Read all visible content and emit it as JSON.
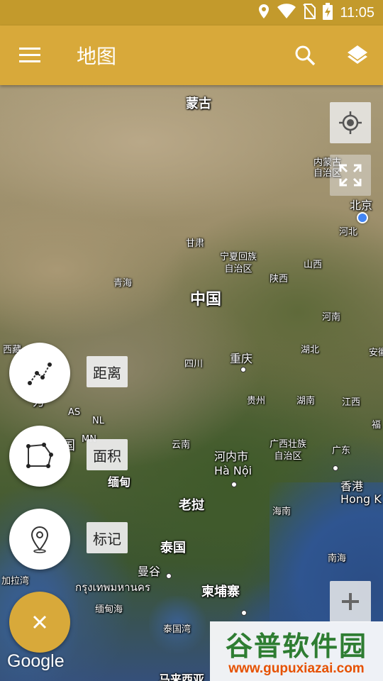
{
  "status_bar": {
    "time": "11:05",
    "icons": [
      "location-icon",
      "wifi-icon",
      "no-sim-icon",
      "battery-charging-icon"
    ]
  },
  "app_bar": {
    "title": "地图",
    "icons": [
      "menu-icon",
      "search-icon",
      "layers-icon"
    ]
  },
  "map": {
    "labels": {
      "mongolia": "蒙古",
      "inner_mongolia": "内蒙古\n自治区",
      "beijing": "北京",
      "hebei": "河北",
      "gansu": "甘肃",
      "ningxia": "宁夏回族\n自治区",
      "shanxi": "山西",
      "shaanxi": "陕西",
      "qinghai": "青海",
      "china": "中国",
      "henan": "河南",
      "tibet": "西藏",
      "sichuan": "四川",
      "chongqing": "重庆",
      "hubei": "湖北",
      "anhui": "安徽",
      "guizhou": "贵州",
      "hunan": "湖南",
      "jiangxi": "江西",
      "fujian": "福",
      "as": "AS",
      "nl": "NL",
      "mn": "MN",
      "yunnan": "云南",
      "hanoi_cn": "河内市",
      "hanoi_vn": "Hà Nội",
      "guangxi": "广西壮族\n自治区",
      "guangdong": "广东",
      "hongkong_cn": "香港",
      "hongkong_en": "Hong K",
      "myanmar": "缅甸",
      "laos": "老挝",
      "hainan": "海南",
      "thailand": "泰国",
      "south_sea": "南海",
      "bangkok_cn": "曼谷",
      "bangkok_th": "กรุงเทพมหานคร",
      "bay_of_bengal": "加拉湾",
      "andaman": "缅甸海",
      "cambodia": "柬埔寨",
      "gulf_thailand": "泰国湾",
      "south_partial": "马来西亚",
      "left_partial_1": "方",
      "left_partial_2": "国"
    },
    "attribution": "Google"
  },
  "controls": {
    "my_location_icon": "crosshair-icon",
    "fullscreen_icon": "fullscreen-icon",
    "zoom_in_icon": "plus-icon"
  },
  "tools": [
    {
      "label": "距离",
      "icon": "polyline-icon"
    },
    {
      "label": "面积",
      "icon": "polygon-icon"
    },
    {
      "label": "标记",
      "icon": "pin-icon"
    }
  ],
  "fab_close_icon": "close-icon",
  "watermark": {
    "main": "谷普软件园",
    "url": "www.gupuxiazai.com"
  },
  "colors": {
    "app_bar": "#d8a93a",
    "status_bar": "#c39a2c",
    "fab": "#d8a93a",
    "location_dot": "#4285f4"
  }
}
